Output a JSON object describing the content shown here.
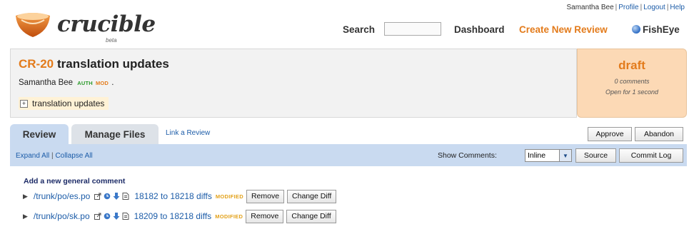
{
  "app": {
    "name": "crucible",
    "tag": "beta"
  },
  "user_nav": {
    "user": "Samantha Bee",
    "profile": "Profile",
    "logout": "Logout",
    "help": "Help"
  },
  "header": {
    "search_label": "Search",
    "search_value": "",
    "dashboard": "Dashboard",
    "create_review": "Create New Review",
    "fisheye": "FishEye"
  },
  "review": {
    "id": "CR-20",
    "title": "translation updates",
    "author": "Samantha Bee",
    "author_badges": [
      "AUTH",
      "MOD"
    ],
    "author_suffix": ".",
    "objectives": "translation updates"
  },
  "state": {
    "label": "draft",
    "comments": "0 comments",
    "open_for": "Open for 1 second"
  },
  "tabs": [
    {
      "label": "Review"
    },
    {
      "label": "Manage Files"
    }
  ],
  "link_review": "Link a Review",
  "actions": {
    "approve": "Approve",
    "abandon": "Abandon"
  },
  "toolbar": {
    "expand_all": "Expand All",
    "separator": "|",
    "collapse_all": "Collapse All",
    "show_comments_label": "Show Comments:",
    "show_comments_value": "Inline",
    "source": "Source",
    "commit_log": "Commit Log"
  },
  "general_comment": "Add a new general comment",
  "files": [
    {
      "path": "/trunk/po/es.po",
      "diffs": "18182 to 18218 diffs",
      "status": "MODIFIED",
      "remove": "Remove",
      "change_diff": "Change Diff"
    },
    {
      "path": "/trunk/po/sk.po",
      "diffs": "18209 to 18218 diffs",
      "status": "MODIFIED",
      "remove": "Remove",
      "change_diff": "Change Diff"
    }
  ],
  "colors": {
    "accent": "#e37b1b",
    "link": "#1c5ca8",
    "toolbar": "#c9daf0",
    "state_panel": "#fcd9b5"
  }
}
